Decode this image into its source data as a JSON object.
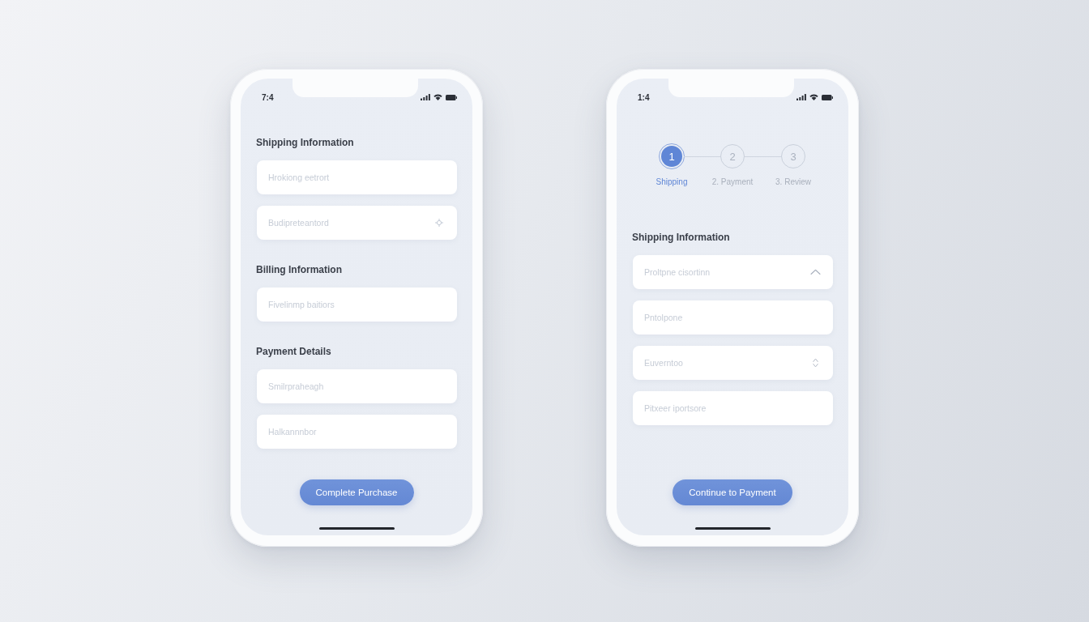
{
  "phones": [
    {
      "status_bar": {
        "time": "7:4"
      },
      "sections": [
        {
          "heading": "Shipping Information",
          "fields": [
            {
              "kind": "text",
              "placeholder": "Hrokiong eetrort"
            },
            {
              "kind": "locate",
              "placeholder": "Budipreteantord"
            }
          ]
        },
        {
          "heading": "Billing Information",
          "fields": [
            {
              "kind": "text",
              "placeholder": "Fivelinmp baitiors"
            }
          ]
        },
        {
          "heading": "Payment Details",
          "fields": [
            {
              "kind": "text",
              "placeholder": "Smilrpraheagh"
            },
            {
              "kind": "text",
              "placeholder": "Halkannnbor"
            }
          ]
        }
      ],
      "button": "Complete Purchase"
    },
    {
      "status_bar": {
        "time": "1:4"
      },
      "stepper": [
        {
          "number": "1",
          "label": "Shipping",
          "selected": true
        },
        {
          "number": "2",
          "label": "2. Payment",
          "selected": false
        },
        {
          "number": "3",
          "label": "3. Review",
          "selected": false
        }
      ],
      "sections": [
        {
          "heading": "Shipping Information",
          "fields": [
            {
              "kind": "dropdown",
              "placeholder": "Proltpne cisortinn"
            },
            {
              "kind": "text",
              "placeholder": "Pntolpone"
            },
            {
              "kind": "spinner",
              "placeholder": "Euverntoo"
            },
            {
              "kind": "text",
              "placeholder": "Pitxeer iportsore"
            }
          ]
        }
      ],
      "button": "Continue to Payment"
    }
  ]
}
